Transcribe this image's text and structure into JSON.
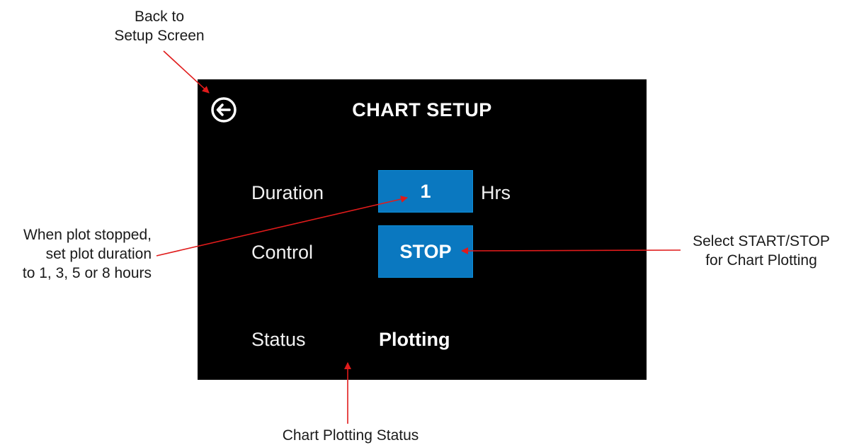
{
  "annotations": {
    "back": [
      "Back to",
      "Setup Screen"
    ],
    "duration": [
      "When plot stopped,",
      "set plot duration",
      "to 1, 3, 5 or 8 hours"
    ],
    "control": [
      "Select START/STOP",
      "for Chart Plotting"
    ],
    "status": [
      "Chart Plotting Status"
    ]
  },
  "screen": {
    "title": "CHART SETUP",
    "back_icon": "arrow-left-circle-icon",
    "duration": {
      "label": "Duration",
      "value": "1",
      "unit": "Hrs"
    },
    "control": {
      "label": "Control",
      "button": "STOP"
    },
    "status": {
      "label": "Status",
      "value": "Plotting"
    }
  },
  "colors": {
    "screen_bg": "#000000",
    "button_bg": "#0a78c0",
    "arrow": "#e01b1b"
  }
}
